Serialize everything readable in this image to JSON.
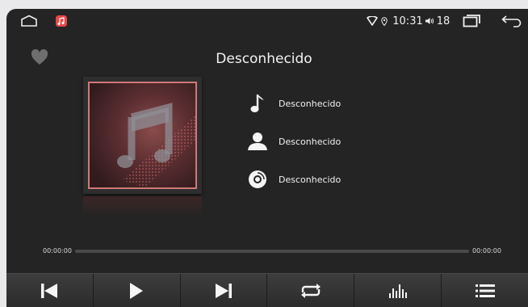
{
  "status_bar": {
    "time": "10:31",
    "volume": "18"
  },
  "player": {
    "title": "Desconhecido",
    "song": "Desconhecido",
    "artist": "Desconhecido",
    "album": "Desconhecido",
    "elapsed": "00:00:00",
    "duration": "00:00:00",
    "progress": 0
  },
  "icons": {
    "home": "home-outline-icon",
    "music_app": "music-app-icon",
    "wifi": "wifi-icon",
    "location": "location-icon",
    "volume": "speaker-icon",
    "recents": "recents-icon",
    "back": "back-arrow-icon",
    "favorite": "heart-icon",
    "song": "music-note-icon",
    "artist": "person-icon",
    "album": "disc-icon",
    "controls": [
      "skip-previous-icon",
      "play-icon",
      "skip-next-icon",
      "repeat-icon",
      "equalizer-icon",
      "playlist-icon"
    ]
  },
  "colors": {
    "background": "#242424",
    "music_app_badge": "#e84848",
    "album_border": "#d07878"
  }
}
